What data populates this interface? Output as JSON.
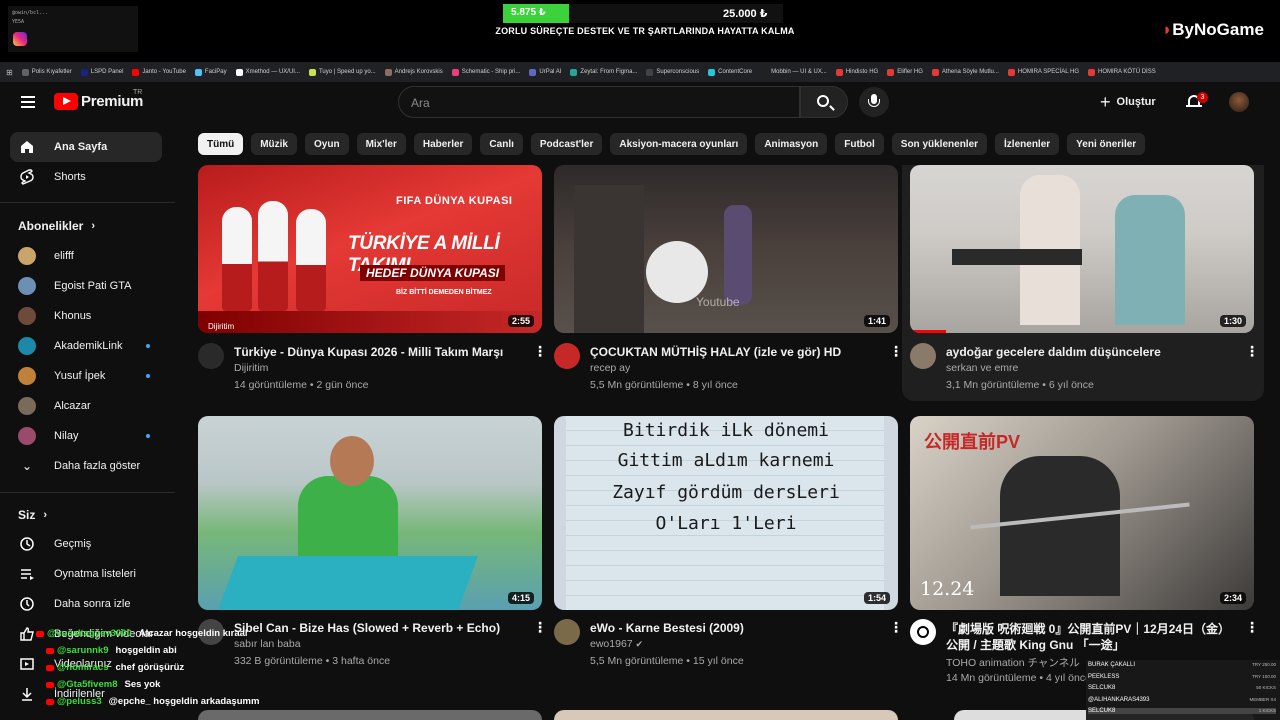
{
  "overlay": {
    "social_handle": "@owin/bcl...",
    "social_sub": "YE5A",
    "donation_current": "5.875 ₺",
    "donation_goal": "25.000 ₺",
    "donation_progress": 0.235,
    "donation_caption": "ZORLU SÜREÇTE DESTEK VE TR ŞARTLARINDA HAYATTA KALMA",
    "sponsor": "ByNoGame"
  },
  "bookmarks": [
    {
      "label": "Polis Kıyafetler",
      "color": "#5f6368"
    },
    {
      "label": "LSPD Panel",
      "color": "#1a237e"
    },
    {
      "label": "Janto - YouTube",
      "color": "#ff0000"
    },
    {
      "label": "FaciPay",
      "color": "#4fc3f7"
    },
    {
      "label": "Xmethod — UX/UI...",
      "color": "#ffffff"
    },
    {
      "label": "Tuyo | Speed up yo...",
      "color": "#c6e14b"
    },
    {
      "label": "Andrejs Korovskis",
      "color": "#8d6e63"
    },
    {
      "label": "Schematic - Ship pri...",
      "color": "#ec407a"
    },
    {
      "label": "UrPal AI",
      "color": "#5c6bc0"
    },
    {
      "label": "Zeytal: From Figma...",
      "color": "#26a69a"
    },
    {
      "label": "Superconscious",
      "color": "#424242"
    },
    {
      "label": "ContentCore",
      "color": "#26c6da"
    },
    {
      "label": "Mobbin — UI & UX...",
      "color": "#212121"
    },
    {
      "label": "Hindisto HG",
      "color": "#e53935"
    },
    {
      "label": "Elifler HG",
      "color": "#e53935"
    },
    {
      "label": "Athena Söyle Mutlu...",
      "color": "#e53935"
    },
    {
      "label": "HOMIRA SPECİAL HG",
      "color": "#e53935"
    },
    {
      "label": "HOMIRA KÖTÜ DİSS",
      "color": "#e53935"
    }
  ],
  "header": {
    "logo_text": "Premium",
    "region": "TR",
    "search_placeholder": "Ara",
    "create_label": "Oluştur",
    "notification_count": "3"
  },
  "sidebar": {
    "home_label": "Ana Sayfa",
    "shorts_label": "Shorts",
    "subscriptions_heading": "Abonelikler",
    "subscriptions": [
      {
        "name": "elifff",
        "color": "#c9a56a",
        "live": false
      },
      {
        "name": "Egoist Pati GTA",
        "color": "#6d8fb3",
        "live": false
      },
      {
        "name": "Khonus",
        "color": "#6e4a3a",
        "live": false
      },
      {
        "name": "AkademikLink",
        "color": "#1e88a8",
        "live": true
      },
      {
        "name": "Yusuf İpek",
        "color": "#c0823a",
        "live": true
      },
      {
        "name": "Alcazar",
        "color": "#7a6a5a",
        "live": false
      },
      {
        "name": "Nilay",
        "color": "#9a4a6a",
        "live": true
      }
    ],
    "show_more_label": "Daha fazla göster",
    "you_heading": "Siz",
    "you_items": [
      {
        "label": "Geçmiş",
        "icon": "history-icon"
      },
      {
        "label": "Oynatma listeleri",
        "icon": "playlists-icon"
      },
      {
        "label": "Daha sonra izle",
        "icon": "watch-later-icon"
      },
      {
        "label": "Beğendiğim videolar",
        "icon": "liked-icon"
      },
      {
        "label": "Videolarınız",
        "icon": "your-videos-icon"
      },
      {
        "label": "İndirilenler",
        "icon": "downloads-icon"
      }
    ]
  },
  "chips": [
    "Tümü",
    "Müzik",
    "Oyun",
    "Mix'ler",
    "Haberler",
    "Canlı",
    "Podcast'ler",
    "Aksiyon-macera oyunları",
    "Animasyon",
    "Futbol",
    "Son yüklenenler",
    "İzlenenler",
    "Yeni öneriler"
  ],
  "videos": [
    {
      "title": "Türkiye - Dünya Kupası 2026 - Milli Takım Marşı",
      "channel": "Dijiritim",
      "meta": "14 görüntüleme • 2 gün önce",
      "duration": "2:55",
      "avatar_color": "#2a2a2a"
    },
    {
      "title": "ÇOCUKTAN MÜTHİŞ HALAY (izle ve gör) HD",
      "channel": "recep ay",
      "meta": "5,5 Mn görüntüleme • 8 yıl önce",
      "duration": "1:41",
      "avatar_color": "#c62828"
    },
    {
      "title": "aydoğar gecelere daldım düşüncelere",
      "channel": "serkan ve emre",
      "meta": "3,1 Mn görüntüleme • 6 yıl önce",
      "duration": "1:30",
      "avatar_color": "#8a7a6a"
    },
    {
      "title": "Sibel Can - Bize Has (Slowed + Reverb + Echo)",
      "channel": "sabır lan baba",
      "meta": "332 B görüntüleme • 3 hafta önce",
      "duration": "4:15",
      "avatar_color": "#444"
    },
    {
      "title": "eWo - Karne Bestesi (2009)",
      "channel": "ewo1967",
      "meta": "5,5 Mn görüntüleme • 15 yıl önce",
      "duration": "1:54",
      "avatar_color": "#7a6a4a"
    },
    {
      "title": "『劇場版 呪術廻戦 0』公開直前PV｜12月24日（金）公開 / 主題歌 King Gnu 「一途」",
      "channel": "TOHO animation チャンネル",
      "meta": "14 Mn görüntüleme • 4 yıl önce",
      "duration": "2:34",
      "avatar_color": "#ffffff"
    }
  ],
  "thumbs": {
    "t1_tag": "FIFA DÜNYA KUPASI",
    "t1_big": "TÜRKİYE A MİLLİ TAKIMI",
    "t1_hedef": "HEDEF DÜNYA KUPASI",
    "t1_small": "BİZ BİTTİ DEMEDEN BİTMEZ",
    "t1_brand": "Dijiritim",
    "t2_watermark": "Youtube",
    "t5_lines": [
      "Bitirdik iLk dönemi",
      "Gittim aLdım karnemi",
      "Zayıf gördüm dersLeri",
      "O'Ları 1'Leri"
    ],
    "t6_jp": "公開直前PV",
    "t6_date": "12.24"
  },
  "chat": [
    {
      "user": "@vusaltagyev3000",
      "msg": "Alcazar hoşgeldin kıraal"
    },
    {
      "user": "@sarunnk9",
      "msg": "hoşgeldin abi"
    },
    {
      "user": "@homiracs",
      "msg": "chef görüşürüz"
    },
    {
      "user": "@Gta5fivem8",
      "msg": "Ses yok"
    },
    {
      "user": "@peluss3",
      "msg": "@epche_ hoşgeldin arkadaşumm"
    }
  ],
  "donors": [
    {
      "name": "BURAK ÇAKALLI",
      "amount": "TRY 250.00"
    },
    {
      "name": "PEEKLESS",
      "amount": "TRY 100.00"
    },
    {
      "name": "SELCUK8",
      "amount": "50 KICKS"
    },
    {
      "name": "@ALIHANKARAS4393",
      "amount": "MEMBER X4"
    },
    {
      "name": "SELCUK8",
      "amount": "1 KICKS"
    }
  ]
}
